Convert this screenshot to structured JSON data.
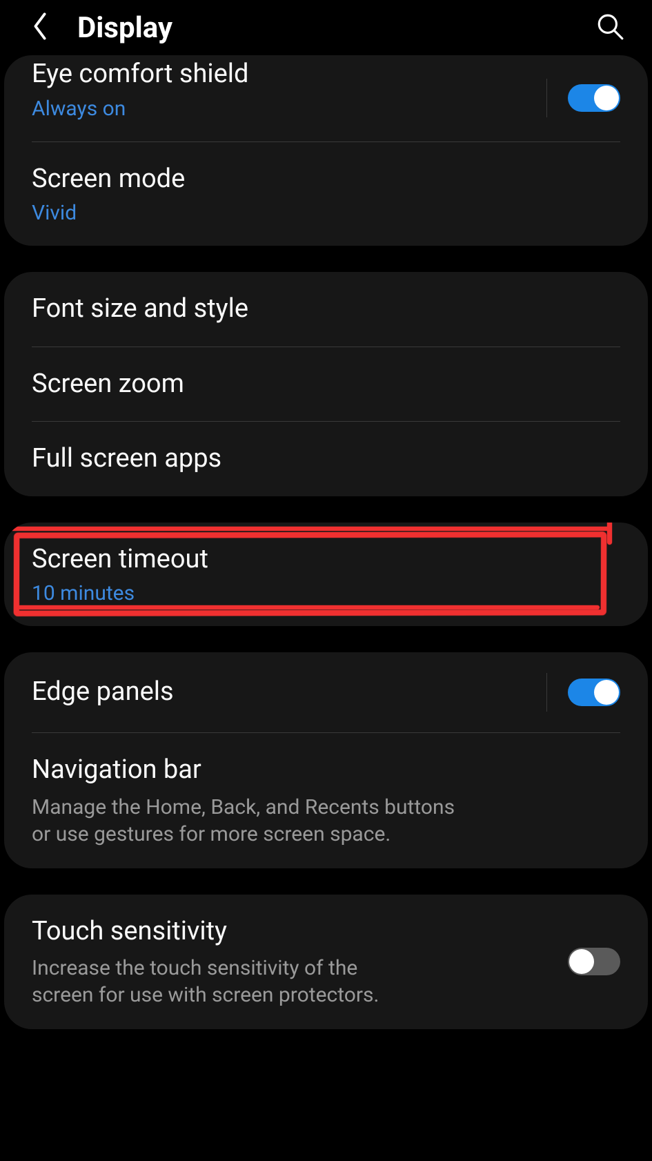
{
  "header": {
    "title": "Display"
  },
  "group1": {
    "eye_comfort": {
      "label": "Eye comfort shield",
      "sub": "Always on",
      "toggle": true
    },
    "screen_mode": {
      "label": "Screen mode",
      "sub": "Vivid"
    }
  },
  "group2": {
    "font": {
      "label": "Font size and style"
    },
    "zoom": {
      "label": "Screen zoom"
    },
    "full": {
      "label": "Full screen apps"
    }
  },
  "group3": {
    "timeout": {
      "label": "Screen timeout",
      "sub": "10 minutes"
    }
  },
  "group4": {
    "edge": {
      "label": "Edge panels",
      "toggle": true
    },
    "nav": {
      "label": "Navigation bar",
      "desc": "Manage the Home, Back, and Recents buttons or use gestures for more screen space."
    }
  },
  "group5": {
    "touch": {
      "label": "Touch sensitivity",
      "desc": "Increase the touch sensitivity of the screen for use with screen protectors.",
      "toggle": false
    }
  }
}
